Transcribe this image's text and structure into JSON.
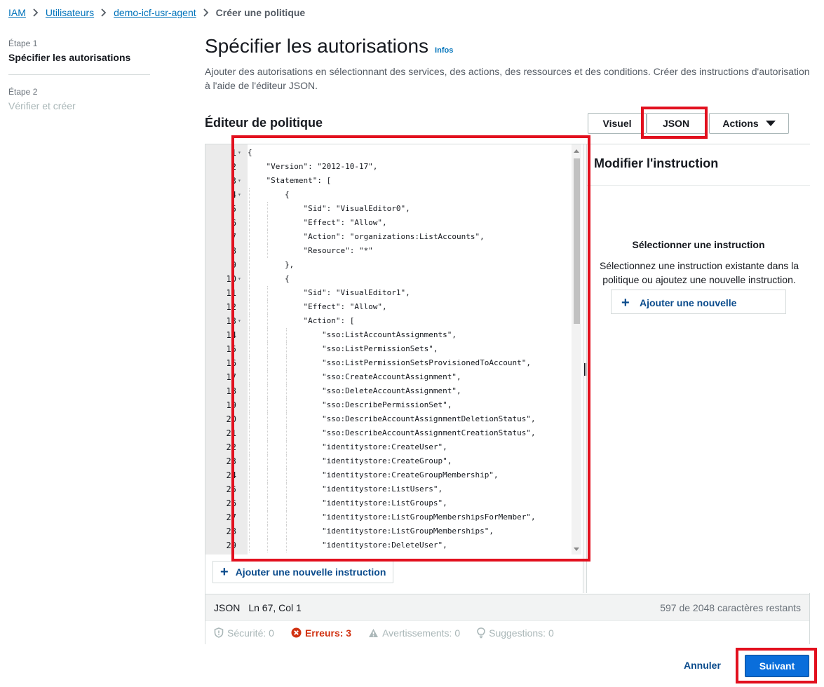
{
  "breadcrumb": {
    "items": [
      "IAM",
      "Utilisateurs",
      "demo-icf-usr-agent"
    ],
    "current": "Créer une politique"
  },
  "steps": [
    {
      "num": "Étape 1",
      "label": "Spécifier les autorisations"
    },
    {
      "num": "Étape 2",
      "label": "Vérifier et créer"
    }
  ],
  "header": {
    "title": "Spécifier les autorisations",
    "info": "Infos",
    "description": "Ajouter des autorisations en sélectionnant des services, des actions, des ressources et des conditions. Créer des instructions d'autorisation à l'aide de l'éditeur JSON."
  },
  "editor": {
    "title": "Éditeur de politique",
    "tabs": {
      "visual": "Visuel",
      "json": "JSON",
      "actions": "Actions"
    },
    "code_lines": [
      "{",
      "    \"Version\": \"2012-10-17\",",
      "    \"Statement\": [",
      "        {",
      "            \"Sid\": \"VisualEditor0\",",
      "            \"Effect\": \"Allow\",",
      "            \"Action\": \"organizations:ListAccounts\",",
      "            \"Resource\": \"*\"",
      "        },",
      "        {",
      "            \"Sid\": \"VisualEditor1\",",
      "            \"Effect\": \"Allow\",",
      "            \"Action\": [",
      "                \"sso:ListAccountAssignments\",",
      "                \"sso:ListPermissionSets\",",
      "                \"sso:ListPermissionSetsProvisionedToAccount\",",
      "                \"sso:CreateAccountAssignment\",",
      "                \"sso:DeleteAccountAssignment\",",
      "                \"sso:DescribePermissionSet\",",
      "                \"sso:DescribeAccountAssignmentDeletionStatus\",",
      "                \"sso:DescribeAccountAssignmentCreationStatus\",",
      "                \"identitystore:CreateUser\",",
      "                \"identitystore:CreateGroup\",",
      "                \"identitystore:CreateGroupMembership\",",
      "                \"identitystore:ListUsers\",",
      "                \"identitystore:ListGroups\",",
      "                \"identitystore:ListGroupMembershipsForMember\",",
      "                \"identitystore:ListGroupMemberships\",",
      "                \"identitystore:DeleteUser\","
    ],
    "fold_lines": [
      1,
      3,
      4,
      10,
      13
    ],
    "add_statement": "Ajouter une nouvelle instruction"
  },
  "right_panel": {
    "title": "Modifier l'instruction",
    "subtitle": "Sélectionner une instruction",
    "description": "Sélectionnez une instruction existante dans la politique ou ajoutez une nouvelle instruction.",
    "add_button": "Ajouter une nouvelle instruction"
  },
  "status": {
    "mode": "JSON",
    "position": "Ln 67, Col 1",
    "remaining": "597 de 2048 caractères restants"
  },
  "lint": {
    "security": "Sécurité: 0",
    "errors": "Erreurs: 3",
    "warnings": "Avertissements: 0",
    "suggestions": "Suggestions: 0"
  },
  "footer": {
    "cancel": "Annuler",
    "next": "Suivant"
  },
  "colors": {
    "highlight": "#e2101e",
    "link": "#0073bb",
    "primary": "#0a6edb",
    "error": "#d13212"
  }
}
